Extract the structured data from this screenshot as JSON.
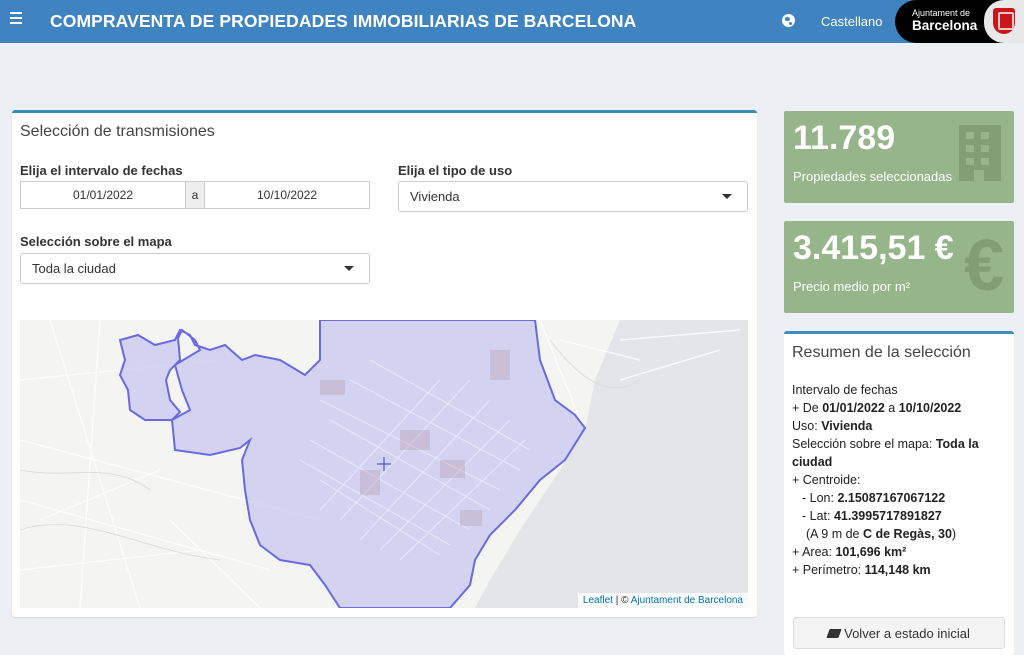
{
  "header": {
    "title": "COMPRAVENTA DE PROPIEDADES IMMOBILIARIAS DE BARCELONA",
    "language": "Castellano",
    "logo_small": "Ajuntament de",
    "logo_big": "Barcelona"
  },
  "selection": {
    "title": "Selección de transmisiones",
    "date_label": "Elija el intervalo de fechas",
    "date_from": "01/01/2022",
    "date_sep": "a",
    "date_to": "10/10/2022",
    "use_label": "Elija el tipo de uso",
    "use_value": "Vivienda",
    "map_label": "Selección sobre el mapa",
    "map_value": "Toda la ciudad"
  },
  "map": {
    "attribution_leaflet": "Leaflet",
    "attribution_sep": " | © ",
    "attribution_source": "Ajuntament de Barcelona"
  },
  "stats": {
    "properties_value": "11.789",
    "properties_label": "Propiedades seleccionadas",
    "price_value": "3.415,51 €",
    "price_label": "Precio medio por m²"
  },
  "summary": {
    "title": "Resumen de la selección",
    "interval_label": "Intervalo de fechas",
    "from_prefix": "+  De ",
    "from": "01/01/2022",
    "to_prefix": "  a ",
    "to": "10/10/2022",
    "use_prefix": "Uso:  ",
    "use": "Vivienda",
    "map_sel_prefix": "Selección sobre el mapa: ",
    "map_sel": "Toda la ciudad",
    "centroid_label": "+  Centroide:",
    "lon_prefix": "- Lon: ",
    "lon": "2.15087167067122",
    "lat_prefix": "- Lat: ",
    "lat": "41.3995717891827",
    "near_prefix": "(A 9 m de ",
    "near": "C de Regàs, 30",
    "near_suffix": ")",
    "area_prefix": "+  Area: ",
    "area": "101,696 km²",
    "perimeter_prefix": "+  Perímetro: ",
    "perimeter": "114,148 km",
    "reset_label": "Volver a estado inicial"
  },
  "colors": {
    "header": "#3f83c1",
    "stat_box": "#97b58b",
    "map_fill": "#c8c8f0",
    "map_outline": "#6a6ae0"
  }
}
